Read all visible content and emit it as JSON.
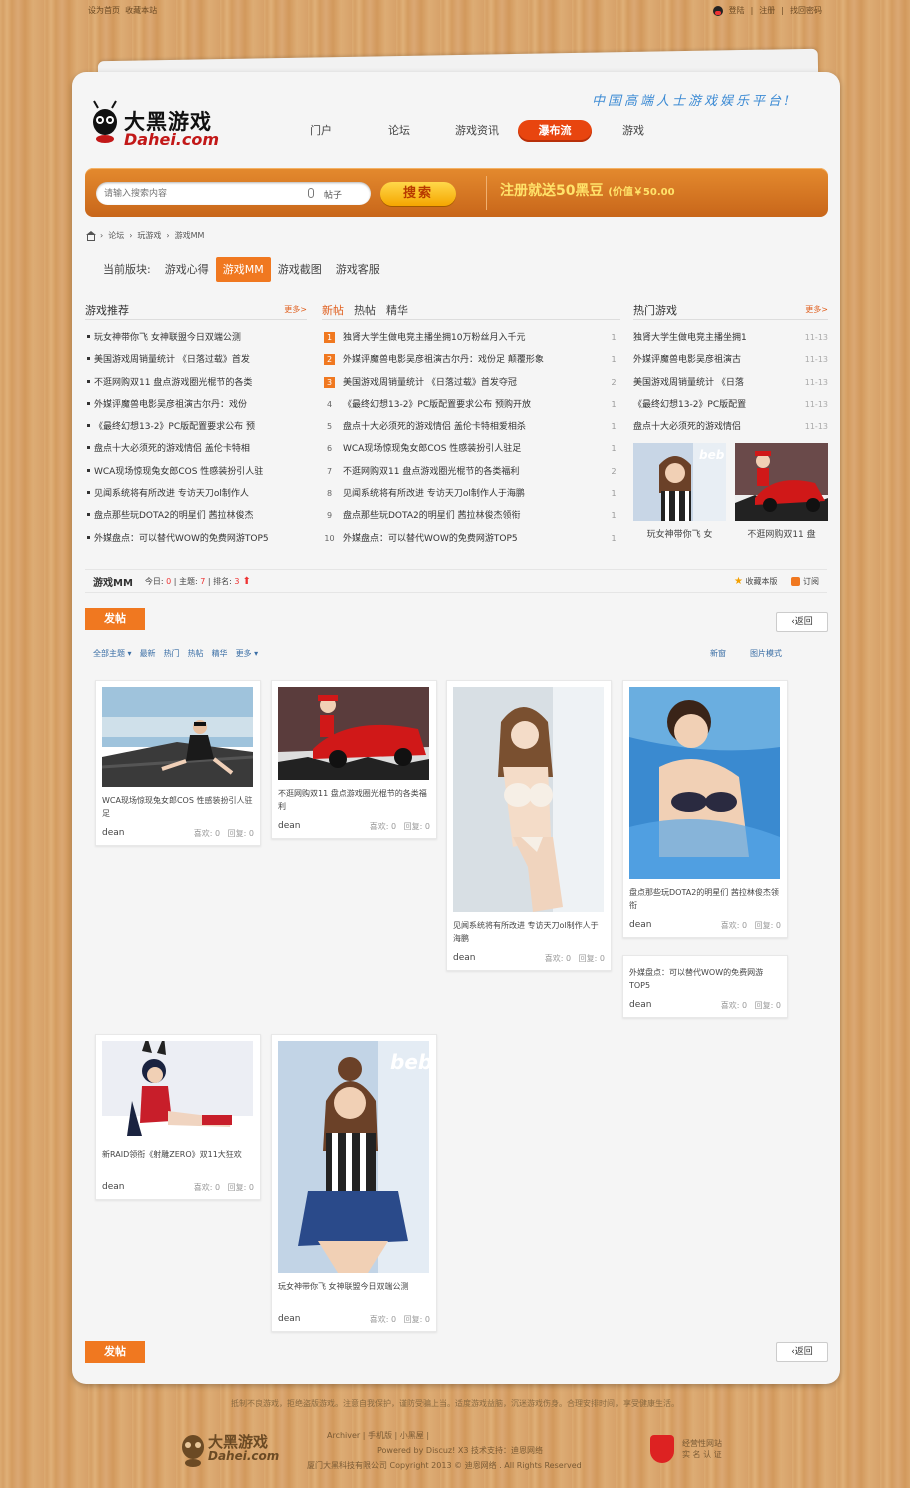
{
  "top_links": {
    "set_home": "设为首页",
    "bookmark": "收藏本站",
    "login": "登陆",
    "register": "注册",
    "find_pw": "找回密码"
  },
  "logo": {
    "cn": "大黑游戏",
    "en": "Dahei.com"
  },
  "slogan": "中国高端人士游戏娱乐平台!",
  "nav": [
    {
      "label": "门户"
    },
    {
      "label": "论坛"
    },
    {
      "label": "游戏资讯"
    },
    {
      "label": "瀑布流",
      "active": true
    },
    {
      "label": "游戏"
    }
  ],
  "search": {
    "placeholder": "请输入搜索内容",
    "scope": "帖子",
    "button": "搜索"
  },
  "promo": {
    "main": "注册就送50黑豆",
    "sub": "(价值￥50.00"
  },
  "breadcrumb": [
    "论坛",
    "玩游戏",
    "游戏MM"
  ],
  "forum_tabs": {
    "label": "当前版块:",
    "items": [
      "游戏心得",
      "游戏MM",
      "游戏截图",
      "游戏客服"
    ],
    "active_index": 1
  },
  "col1": {
    "title": "游戏推荐",
    "more": "更多>",
    "items": [
      "玩女神带你飞 女神联盟今日双端公测",
      "美国游戏周销量统计 《日落过载》首发",
      "不逛网购双11 盘点游戏圈光棍节的各类",
      "外媒评魔兽电影吴彦祖演古尔丹：戏份",
      "《最终幻想13-2》PC版配置要求公布 预",
      "盘点十大必须死的游戏情侣 盖伦卡特相",
      "WCA现场惊现兔女郎COS 性感装扮引人驻",
      "见闻系统将有所改进 专访天刀ol制作人",
      "盘点那些玩DOTA2的明星们 茜拉林俊杰",
      "外媒盘点：可以替代WOW的免费网游TOP5"
    ]
  },
  "col2": {
    "tabs": [
      "新帖",
      "热帖",
      "精华"
    ],
    "items": [
      {
        "n": "1",
        "t": "独肾大学生做电竞主播坐拥10万粉丝月入千元",
        "c": "1"
      },
      {
        "n": "2",
        "t": "外媒评魔兽电影吴彦祖演古尔丹：戏份足 颠覆形象",
        "c": "1"
      },
      {
        "n": "3",
        "t": "美国游戏周销量统计 《日落过载》首发夺冠",
        "c": "2"
      },
      {
        "n": "4",
        "t": "《最终幻想13-2》PC版配置要求公布 预购开放",
        "c": "1"
      },
      {
        "n": "5",
        "t": "盘点十大必须死的游戏情侣 盖伦卡特相爱相杀",
        "c": "1"
      },
      {
        "n": "6",
        "t": "WCA现场惊现兔女郎COS 性感装扮引人驻足",
        "c": "1"
      },
      {
        "n": "7",
        "t": "不逛网购双11 盘点游戏圈光棍节的各类福利",
        "c": "2"
      },
      {
        "n": "8",
        "t": "见闻系统将有所改进 专访天刀ol制作人于海鹏",
        "c": "1"
      },
      {
        "n": "9",
        "t": "盘点那些玩DOTA2的明星们 茜拉林俊杰领衔",
        "c": "1"
      },
      {
        "n": "10",
        "t": "外媒盘点：可以替代WOW的免费网游TOP5",
        "c": "1"
      }
    ]
  },
  "col3": {
    "title": "热门游戏",
    "more": "更多>",
    "items": [
      {
        "t": "独肾大学生做电竞主播坐拥1",
        "d": "11-13"
      },
      {
        "t": "外媒评魔兽电影吴彦祖演古",
        "d": "11-13"
      },
      {
        "t": "美国游戏周销量统计 《日落",
        "d": "11-13"
      },
      {
        "t": "《最终幻想13-2》PC版配置",
        "d": "11-13"
      },
      {
        "t": "盘点十大必须死的游戏情侣",
        "d": "11-13"
      }
    ],
    "thumbs": [
      "玩女神带你飞 女",
      "不逛网购双11 盘"
    ]
  },
  "stats": {
    "forum": "游戏MM",
    "today_label": "今日:",
    "today": "0",
    "topic_label": "主题:",
    "topic": "7",
    "rank_label": "排名:",
    "rank": "3",
    "fav": "收藏本版",
    "rss": "订阅"
  },
  "actions": {
    "post": "发帖",
    "back": "返回"
  },
  "filter": {
    "items": [
      "全部主题",
      "最新",
      "热门",
      "热帖",
      "精华",
      "更多"
    ],
    "right": [
      "新窗",
      "图片模式"
    ]
  },
  "waterfall": [
    {
      "title": "WCA现场惊现兔女郎COS 性感装扮引人驻足",
      "user": "dean",
      "like": "喜欢: 0",
      "reply": "回复: 0"
    },
    {
      "title": "不逛网购双11 盘点游戏圈光棍节的各类福利",
      "user": "dean",
      "like": "喜欢: 0",
      "reply": "回复: 0"
    },
    {
      "title": "见闻系统将有所改进 专访天刀ol制作人于海鹏",
      "user": "dean",
      "like": "喜欢: 0",
      "reply": "回复: 0"
    },
    {
      "title": "盘点那些玩DOTA2的明星们 茜拉林俊杰领衔",
      "user": "dean",
      "like": "喜欢: 0",
      "reply": "回复: 0"
    },
    {
      "title": "外媒盘点：可以替代WOW的免费网游TOP5",
      "user": "dean",
      "like": "喜欢: 0",
      "reply": "回复: 0"
    },
    {
      "title": "新RAID领衔《射雕ZERO》双11大狂欢",
      "user": "dean",
      "like": "喜欢: 0",
      "reply": "回复: 0"
    },
    {
      "title": "玩女神带你飞 女神联盟今日双端公测",
      "user": "dean",
      "like": "喜欢: 0",
      "reply": "回复: 0"
    }
  ],
  "footer": {
    "notice": "抵制不良游戏，拒绝盗版游戏。注意自我保护，谨防受骗上当。适度游戏益脑，沉迷游戏伤身。合理安排时间，享受健康生活。",
    "line1": "Archiver  |  手机版  |  小黑屋  |",
    "line2": "Powered by Discuz! X3    技术支持：迪恩网络",
    "line3": "厦门大黑科技有限公司  Copyright 2013 © 迪恩网络 . All Rights Reserved",
    "cert1": "经营性网站",
    "cert2": "实 名 认 证"
  }
}
